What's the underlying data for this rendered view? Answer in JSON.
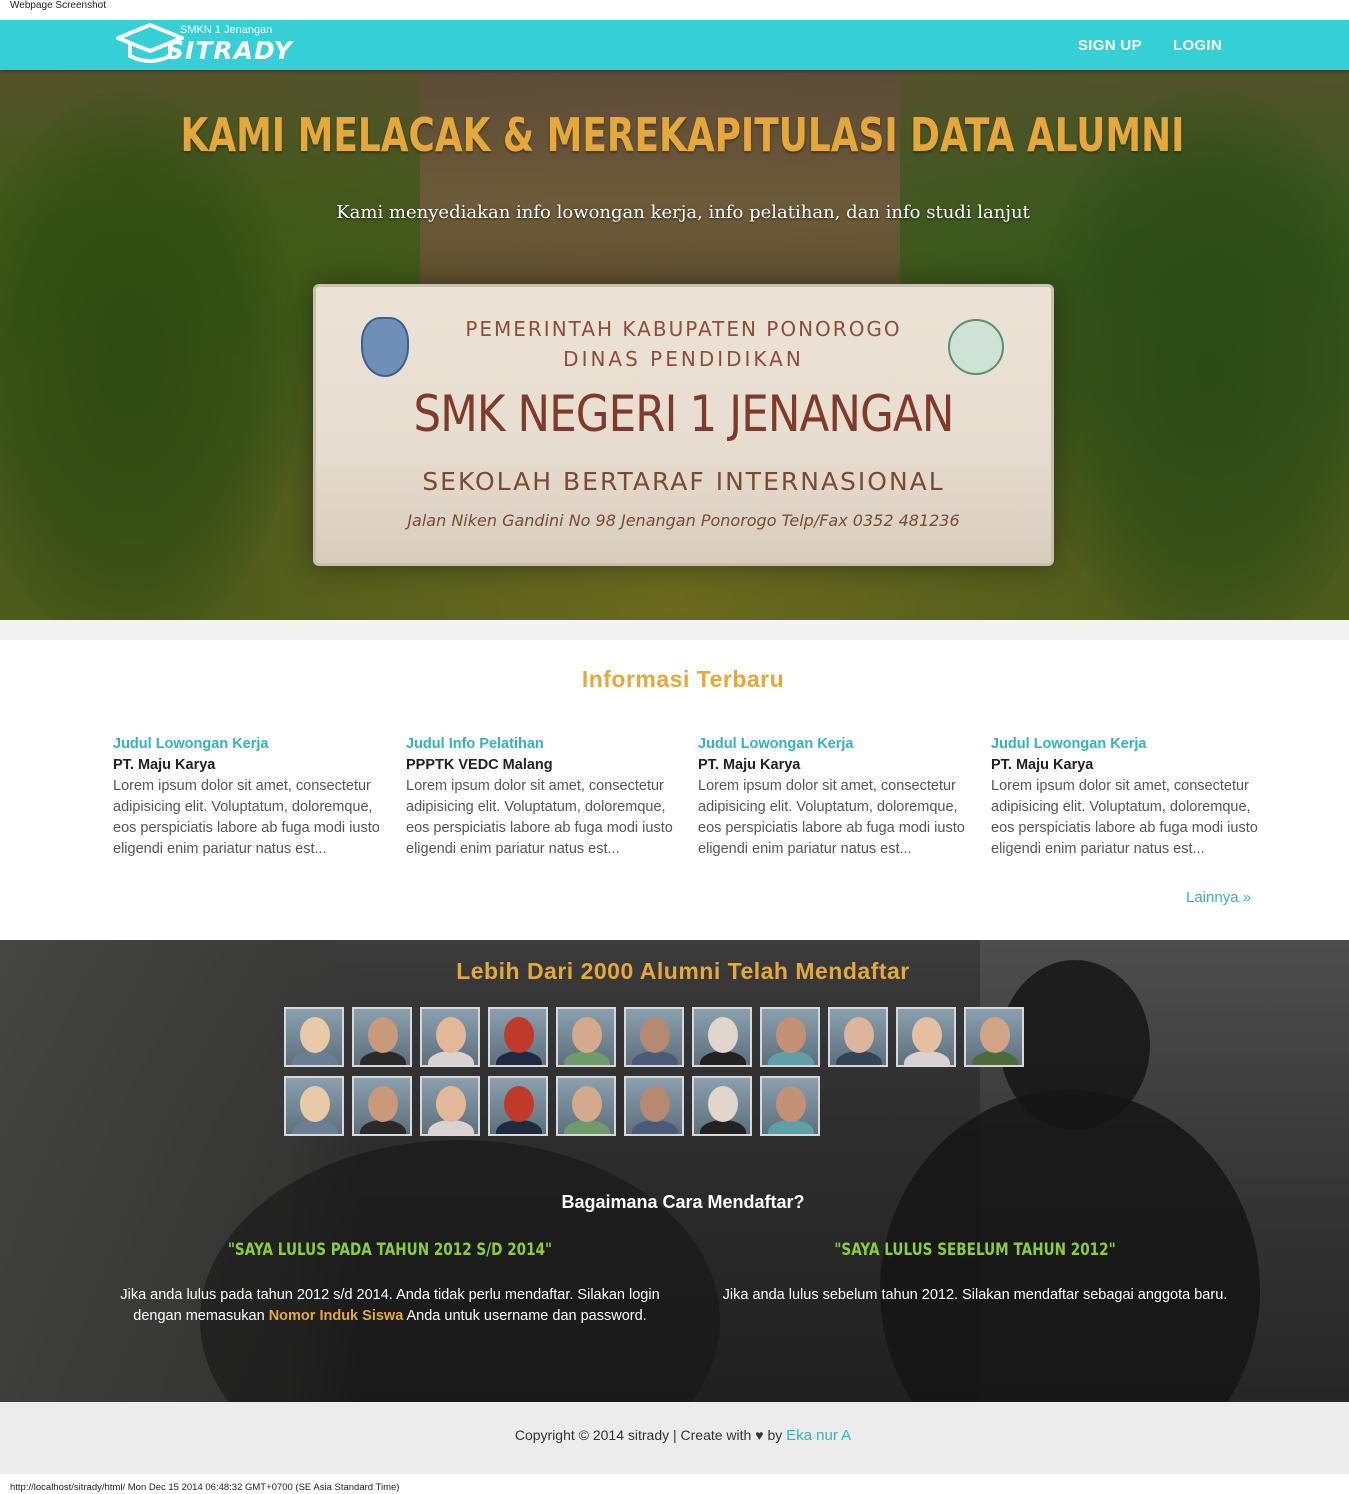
{
  "screenshot_caption": "Webpage Screenshot",
  "navbar": {
    "brand_sub": "SMKN 1 Jenangan",
    "brand_name": "SITRADY",
    "signup_label": "SIGN UP",
    "login_label": "LOGIN",
    "color": "#35d0d6"
  },
  "hero": {
    "title": "KAMI MELACAK & MEREKAPITULASI DATA ALUMNI",
    "subtitle": "Kami menyediakan info lowongan kerja, info pelatihan, dan info studi lanjut",
    "sign": {
      "line1": "PEMERINTAH KABUPATEN PONOROGO",
      "line2": "DINAS PENDIDIKAN",
      "line3": "SMK NEGERI 1 JENANGAN",
      "line4": "SEKOLAH BERTARAF INTERNASIONAL",
      "line5": "Jalan Niken Gandini No 98 Jenangan Ponorogo Telp/Fax 0352 481236"
    }
  },
  "info": {
    "title": "Informasi Terbaru",
    "cards": [
      {
        "title": "Judul Lowongan Kerja",
        "company": "PT. Maju Karya",
        "body": "Lorem ipsum dolor sit amet, consectetur adipisicing elit. Voluptatum, doloremque, eos perspiciatis labore ab fuga modi iusto eligendi enim pariatur natus est..."
      },
      {
        "title": "Judul Info Pelatihan",
        "company": "PPPTK VEDC Malang",
        "body": "Lorem ipsum dolor sit amet, consectetur adipisicing elit. Voluptatum, doloremque, eos perspiciatis labore ab fuga modi iusto eligendi enim pariatur natus est..."
      },
      {
        "title": "Judul Lowongan Kerja",
        "company": "PT. Maju Karya",
        "body": "Lorem ipsum dolor sit amet, consectetur adipisicing elit. Voluptatum, doloremque, eos perspiciatis labore ab fuga modi iusto eligendi enim pariatur natus est..."
      },
      {
        "title": "Judul Lowongan Kerja",
        "company": "PT. Maju Karya",
        "body": "Lorem ipsum dolor sit amet, consectetur adipisicing elit. Voluptatum, doloremque, eos perspiciatis labore ab fuga modi iusto eligendi enim pariatur natus est..."
      }
    ],
    "more_label": "Lainnya »"
  },
  "alumni": {
    "title": "Lebih Dari 2000 Alumni Telah Mendaftar",
    "avatar_count": 19,
    "how_title": "Bagaimana Cara Mendaftar?",
    "option1": {
      "quote": "\"SAYA LULUS PADA TAHUN 2012 S/D 2014\"",
      "text_before": "Jika anda lulus pada tahun 2012 s/d 2014. Anda tidak perlu mendaftar. Silakan login dengan memasukan ",
      "highlight": "Nomor Induk Siswa",
      "text_after": " Anda untuk username dan password."
    },
    "option2": {
      "quote": "\"SAYA LULUS SEBELUM TAHUN 2012\"",
      "text": "Jika anda lulus sebelum tahun 2012. Silakan mendaftar sebagai anggota baru."
    }
  },
  "footer": {
    "text": "Copyright © 2014 sitrady | Create with",
    "by": "by",
    "author": "Eka nur A"
  },
  "status_bar": "http://localhost/sitrady/html/ Mon Dec 15 2014 06:48:32 GMT+0700 (SE Asia Standard Time)"
}
